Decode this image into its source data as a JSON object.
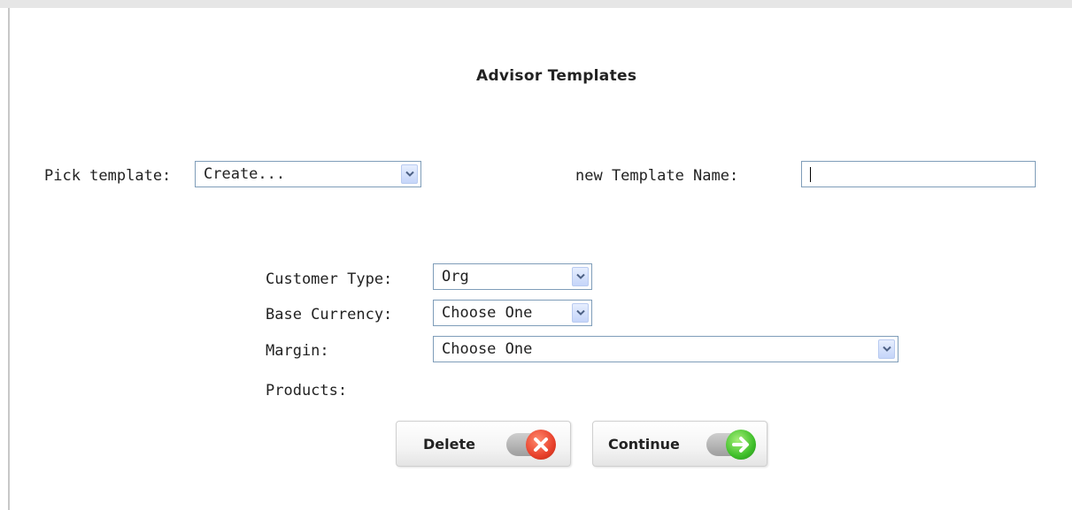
{
  "page": {
    "title": "Advisor Templates"
  },
  "template_picker": {
    "label": "Pick template:",
    "selected": "Create...",
    "new_name_label": "new Template Name:",
    "new_name_value": ""
  },
  "form": {
    "customer_type": {
      "label": "Customer Type:",
      "selected": "Org"
    },
    "base_currency": {
      "label": "Base Currency:",
      "selected": "Choose One"
    },
    "margin": {
      "label": "Margin:",
      "selected": "Choose One"
    },
    "products": {
      "label": "Products:"
    }
  },
  "buttons": {
    "delete": {
      "label": "Delete",
      "icon": "x-circle-icon",
      "color": "#e8412c"
    },
    "continue": {
      "label": "Continue",
      "icon": "arrow-right-circle-icon",
      "color": "#3fbf2a"
    }
  }
}
